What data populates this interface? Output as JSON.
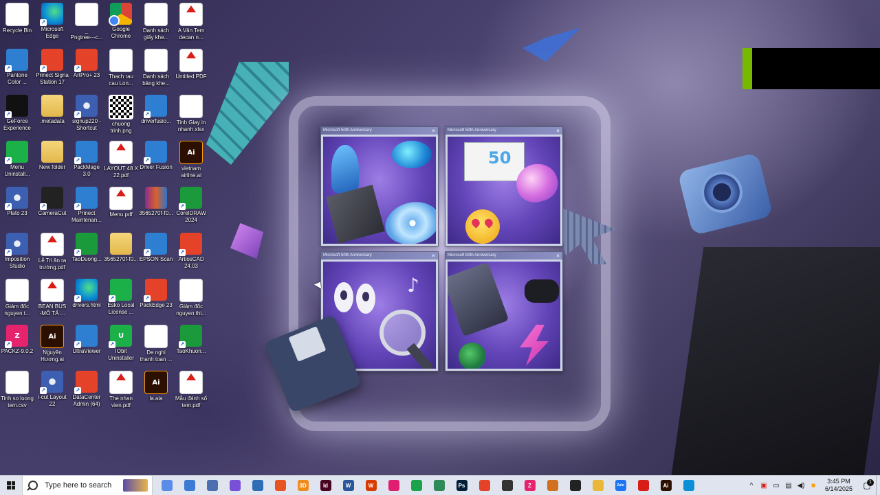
{
  "desktop": {
    "icons": [
      {
        "label": "Recycle Bin",
        "icon": "recycle-bin-icon",
        "badge": ""
      },
      {
        "label": "Microsoft\nEdge",
        "icon": "edge-icon",
        "badge": ""
      },
      {
        "label": "_\nPngtree---c...",
        "icon": "image-file-icon",
        "badge": ""
      },
      {
        "label": "Google\nChrome",
        "icon": "chrome-icon",
        "badge": ""
      },
      {
        "label": "Danh sách\ngiấy khe...",
        "icon": "excel-icon",
        "badge": "X"
      },
      {
        "label": "A Vân Tem\ndecan n...",
        "icon": "pdf-icon",
        "badge": "PDF"
      },
      {
        "label": "Pantone\nColor ...",
        "icon": "pantone-icon",
        "badge": ""
      },
      {
        "label": "Prinect Signa\nStation 17",
        "icon": "prinect-signa-icon",
        "badge": ""
      },
      {
        "label": "ArtPro+ 23",
        "icon": "artpro-icon",
        "badge": ""
      },
      {
        "label": "Thach rau\ncau Lon...",
        "icon": "image-file-icon",
        "badge": ""
      },
      {
        "label": "Danh sách\nbảng khe...",
        "icon": "excel-icon",
        "badge": "X"
      },
      {
        "label": "Untitled.PDF",
        "icon": "pdf-icon",
        "badge": "PDF"
      },
      {
        "label": "GeForce\nExperience",
        "icon": "nvidia-icon",
        "badge": ""
      },
      {
        "label": ".metadata",
        "icon": "folder-icon",
        "badge": ""
      },
      {
        "label": "signup220 -\nShortcut",
        "icon": "gear-icon",
        "badge": ""
      },
      {
        "label": "chuong\ntrinh.png",
        "icon": "qr-code-icon",
        "badge": ""
      },
      {
        "label": "driverfusio...",
        "icon": "wrench-icon",
        "badge": ""
      },
      {
        "label": "Tinh Giay in\nnhanh.xlsx",
        "icon": "excel-icon",
        "badge": "X"
      },
      {
        "label": "Menu\nUninstall...",
        "icon": "menu-uninstall-icon",
        "badge": ""
      },
      {
        "label": "New folder",
        "icon": "folder-icon",
        "badge": ""
      },
      {
        "label": "PackMage\n3.0",
        "icon": "packmage-icon",
        "badge": ""
      },
      {
        "label": "LAYOUT 48 X\n22.pdf",
        "icon": "pdf-icon",
        "badge": "PDF"
      },
      {
        "label": "Driver Fusion",
        "icon": "wrench-icon",
        "badge": ""
      },
      {
        "label": "vietnam\nairline.ai",
        "icon": "illustrator-icon",
        "badge": "Ai"
      },
      {
        "label": "Plato 23",
        "icon": "plato-icon",
        "badge": ""
      },
      {
        "label": "CameraCut",
        "icon": "cameracut-icon",
        "badge": ""
      },
      {
        "label": "Prinect\nMaintenan...",
        "icon": "prinect-maintenance-icon",
        "badge": ""
      },
      {
        "label": "Menu.pdf",
        "icon": "pdf-icon",
        "badge": "PDF"
      },
      {
        "label": "3565270f-f0...",
        "icon": "winrar-icon",
        "badge": ""
      },
      {
        "label": "CorelDRAW\n2024",
        "icon": "coreldraw-icon",
        "badge": ""
      },
      {
        "label": "Imposition\nStudio",
        "icon": "imposition-studio-icon",
        "badge": ""
      },
      {
        "label": "Lễ Tri ân ra\ntrường.pdf",
        "icon": "pdf-icon",
        "badge": "PDF"
      },
      {
        "label": "TaoDuong...",
        "icon": "coreldraw-icon",
        "badge": ""
      },
      {
        "label": "3565270f-f0...",
        "icon": "folder-icon",
        "badge": ""
      },
      {
        "label": "EPSON Scan",
        "icon": "scanner-icon",
        "badge": ""
      },
      {
        "label": "ArtiosCAD\n24.03",
        "icon": "artioscad-icon",
        "badge": ""
      },
      {
        "label": "Giám đốc\nnguyen t...",
        "icon": "image-file-icon",
        "badge": ""
      },
      {
        "label": "BEAN BUS\n-MÔ TẢ ...",
        "icon": "pdf-icon",
        "badge": "PDF"
      },
      {
        "label": "drivers.html",
        "icon": "edge-icon",
        "badge": ""
      },
      {
        "label": "Esko Local\nLicense ...",
        "icon": "esko-icon",
        "badge": ""
      },
      {
        "label": "PackEdge 23",
        "icon": "packedge-icon",
        "badge": ""
      },
      {
        "label": "Giám đốc\nnguyen thi...",
        "icon": "image-file-icon",
        "badge": ""
      },
      {
        "label": "PACKZ-9.0.2",
        "icon": "packz-icon",
        "badge": "Z"
      },
      {
        "label": "Nguyên\nHương.ai",
        "icon": "illustrator-icon",
        "badge": "Ai"
      },
      {
        "label": "UltraViewer",
        "icon": "ultraviewer-icon",
        "badge": ""
      },
      {
        "label": "IObit\nUninstaller",
        "icon": "iobit-icon",
        "badge": "U"
      },
      {
        "label": "De nghi\nthanh toan ...",
        "icon": "word-icon",
        "badge": "W"
      },
      {
        "label": "TaoKhuon...",
        "icon": "coreldraw-icon",
        "badge": ""
      },
      {
        "label": "Tinh so luong\ntem.csv",
        "icon": "excel-icon",
        "badge": "X"
      },
      {
        "label": "i-cut Layout\n22",
        "icon": "icut-icon",
        "badge": ""
      },
      {
        "label": "DataCenter\nAdmin (64)",
        "icon": "datacenter-icon",
        "badge": ""
      },
      {
        "label": "The nhan\nvien.pdf",
        "icon": "pdf-icon",
        "badge": "PDF"
      },
      {
        "label": "la.aia",
        "icon": "illustrator-icon",
        "badge": "Ai"
      },
      {
        "label": "Mẫu đánh số\ntem.pdf",
        "icon": "pdf-icon",
        "badge": "PDF"
      }
    ]
  },
  "wallpaper": {
    "windows": [
      {
        "title": "Microsoft 50th Anniversary",
        "close": "×"
      },
      {
        "title": "Microsoft 50th Anniversary",
        "close": "×"
      },
      {
        "title": "Microsoft 50th Anniversary",
        "close": "×"
      },
      {
        "title": "Microsoft 50th Anniversary",
        "close": "×"
      }
    ],
    "paint_text": "50",
    "note_glyph": "♪"
  },
  "taskbar": {
    "search_placeholder": "Type here to search",
    "apps": [
      {
        "icon": "cortana-icon",
        "color": "#5b8de8",
        "glyph": ""
      },
      {
        "icon": "scanner-icon",
        "color": "#3a7bd5",
        "glyph": ""
      },
      {
        "icon": "maps-icon",
        "color": "#4b6fb0",
        "glyph": ""
      },
      {
        "icon": "photos-icon",
        "color": "#7a4fd8",
        "glyph": ""
      },
      {
        "icon": "calculator-icon",
        "color": "#2f6db5",
        "glyph": ""
      },
      {
        "icon": "artpro-icon",
        "color": "#e8541f",
        "glyph": ""
      },
      {
        "icon": "3d-viewer-icon",
        "color": "#f08a1c",
        "glyph": "3D"
      },
      {
        "icon": "indesign-icon",
        "color": "#49021f",
        "glyph": "Id"
      },
      {
        "icon": "word-icon",
        "color": "#2b579a",
        "glyph": "W"
      },
      {
        "icon": "office-icon",
        "color": "#d83b01",
        "glyph": "W"
      },
      {
        "icon": "record-icon",
        "color": "#e01f73",
        "glyph": ""
      },
      {
        "icon": "coreldraw-icon",
        "color": "#1aa34a",
        "glyph": ""
      },
      {
        "icon": "pantone-icon",
        "color": "#2f8a5a",
        "glyph": ""
      },
      {
        "icon": "photoshop-icon",
        "color": "#001e36",
        "glyph": "Ps"
      },
      {
        "icon": "artioscad-icon",
        "color": "#e4432a",
        "glyph": ""
      },
      {
        "icon": "apps-grid-icon",
        "color": "#333333",
        "glyph": ""
      },
      {
        "icon": "packz-icon",
        "color": "#e6246e",
        "glyph": "Z"
      },
      {
        "icon": "packedge-icon",
        "color": "#d1701e",
        "glyph": ""
      },
      {
        "icon": "obs-icon",
        "color": "#222222",
        "glyph": ""
      },
      {
        "icon": "file-explorer-icon",
        "color": "#e9b83a",
        "glyph": ""
      },
      {
        "icon": "zalo-icon",
        "color": "#1d74f5",
        "glyph": "Zalo"
      },
      {
        "icon": "acrobat-icon",
        "color": "#d91e18",
        "glyph": ""
      },
      {
        "icon": "illustrator-icon",
        "color": "#2b0f00",
        "glyph": "Ai"
      },
      {
        "icon": "edge-icon",
        "color": "#0b8fd6",
        "glyph": ""
      }
    ],
    "tray": {
      "chevron": "^",
      "icons": [
        "acrobat-tray-icon",
        "screen-icon",
        "network-icon",
        "volume-icon",
        "ai-tray-icon"
      ],
      "time": "3:45 PM",
      "date": "6/14/2025",
      "notification_count": "1"
    }
  },
  "colors": {
    "taskbar_bg": "#dfe4ee",
    "nvidia_green": "#76b900",
    "wallpaper_purple": "#6244b8"
  }
}
